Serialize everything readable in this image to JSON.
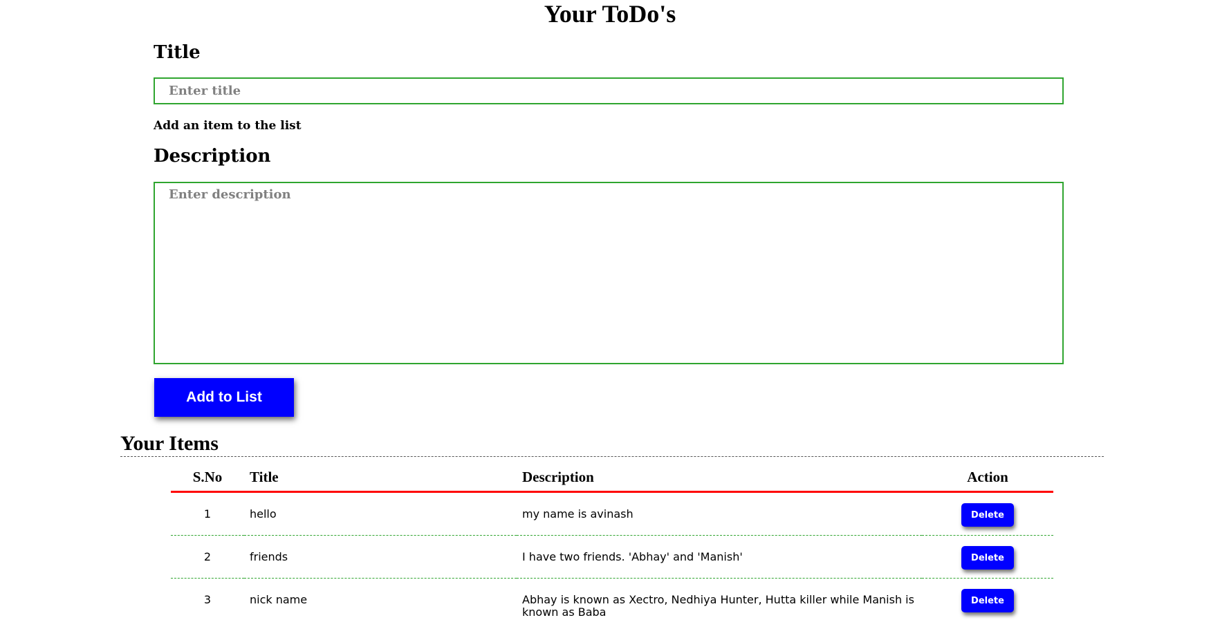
{
  "page": {
    "title": "Your ToDo's"
  },
  "form": {
    "title_label": "Title",
    "title_placeholder": "Enter title",
    "title_value": "",
    "helper_text": "Add an item to the list",
    "description_label": "Description",
    "description_placeholder": "Enter description",
    "description_value": "",
    "add_button_label": "Add to List"
  },
  "items_section": {
    "heading": "Your Items",
    "columns": {
      "sno": "S.No",
      "title": "Title",
      "description": "Description",
      "action": "Action"
    },
    "rows": [
      {
        "sno": "1",
        "title": "hello",
        "description": "my name is avinash",
        "action": "Delete"
      },
      {
        "sno": "2",
        "title": "friends",
        "description": "I have two friends. 'Abhay' and 'Manish'",
        "action": "Delete"
      },
      {
        "sno": "3",
        "title": "nick name",
        "description": "Abhay is known as Xectro, Nedhiya Hunter, Hutta killer while Manish is known as Baba",
        "action": "Delete"
      }
    ]
  },
  "colors": {
    "accent_blue": "#0000ff",
    "field_border_green": "#2fa52f",
    "header_rule_red": "#ff0000"
  }
}
